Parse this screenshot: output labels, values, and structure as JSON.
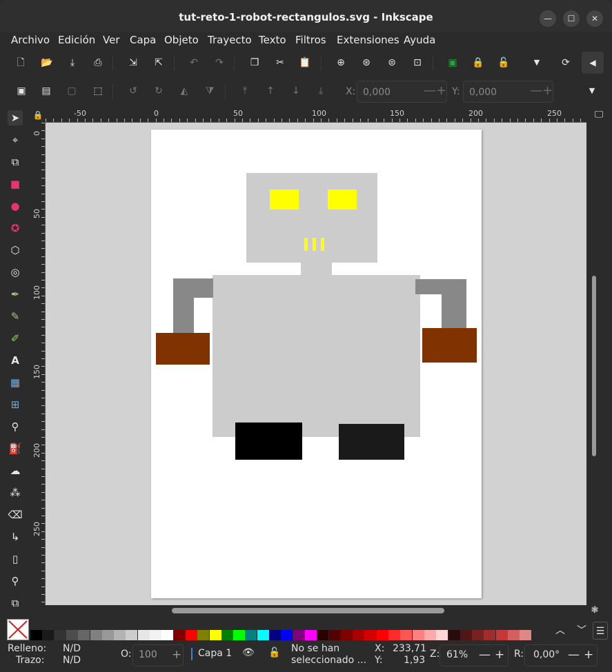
{
  "window": {
    "title": "tut-reto-1-robot-rectangulos.svg - Inkscape",
    "controls": {
      "minimize": "—",
      "maximize": "☐",
      "close": "✕"
    }
  },
  "menu": [
    "Archivo",
    "Edición",
    "Ver",
    "Capa",
    "Objeto",
    "Trayecto",
    "Texto",
    "Filtros",
    "Extensiones",
    "Ayuda"
  ],
  "commands": [
    {
      "name": "new-document-icon",
      "glyph": "🗋"
    },
    {
      "name": "open-icon",
      "glyph": "📂"
    },
    {
      "name": "save-icon",
      "glyph": "⤓"
    },
    {
      "name": "print-icon",
      "glyph": "⎙"
    },
    {
      "name": "import-icon",
      "glyph": "⇲"
    },
    {
      "name": "export-icon",
      "glyph": "⇱"
    },
    {
      "name": "undo-icon",
      "glyph": "↶"
    },
    {
      "name": "redo-icon",
      "glyph": "↷"
    },
    {
      "name": "duplicate-icon",
      "glyph": "❐"
    },
    {
      "name": "cut-icon",
      "glyph": "✂"
    },
    {
      "name": "paste-icon",
      "glyph": "📋"
    },
    {
      "name": "zoom-selection-icon",
      "glyph": "⊕"
    },
    {
      "name": "zoom-drawing-icon",
      "glyph": "⊛"
    },
    {
      "name": "zoom-page-icon",
      "glyph": "⊜"
    },
    {
      "name": "zoom-center-icon",
      "glyph": "⊡"
    },
    {
      "name": "group-icon",
      "glyph": "▣"
    },
    {
      "name": "lock-object-icon",
      "glyph": "🔒"
    },
    {
      "name": "unlock-object-icon",
      "glyph": "🔓"
    },
    {
      "name": "more-dropdown-icon",
      "glyph": "▼"
    },
    {
      "name": "sync-icon",
      "glyph": "⟳"
    },
    {
      "name": "collapse-panel-icon",
      "glyph": "◀"
    }
  ],
  "controls": {
    "x_label": "X:",
    "x_value": "0,000",
    "y_label": "Y:",
    "y_value": "0,000",
    "minus": "—",
    "plus": "+"
  },
  "ruler": {
    "top_labels": [
      "-50",
      "0",
      "50",
      "100",
      "150",
      "200",
      "250"
    ],
    "left_labels": [
      "0",
      "50",
      "100",
      "150",
      "200",
      "250"
    ]
  },
  "drawing": {
    "page_color": "#ffffff",
    "canvas_color": "#d2d2d2",
    "head_color": "#cccccc",
    "eye_color": "#ffff00",
    "body_color": "#cccccc",
    "arm_color": "#888888",
    "hand_color": "#803300",
    "foot_left_color": "#000000",
    "foot_right_color": "#1a1a1a"
  },
  "palette": {
    "none_icon": "no-paint-icon",
    "colors": [
      "#000000",
      "#1a1a1a",
      "#333333",
      "#4d4d4d",
      "#666666",
      "#808080",
      "#999999",
      "#b3b3b3",
      "#cccccc",
      "#e6e6e6",
      "#f2f2f2",
      "#ffffff",
      "#800000",
      "#ff0000",
      "#808000",
      "#ffff00",
      "#008000",
      "#00ff00",
      "#008080",
      "#00ffff",
      "#000080",
      "#0000ff",
      "#800080",
      "#ff00ff",
      "#2b0000",
      "#550000",
      "#800000",
      "#aa0000",
      "#d40000",
      "#ff0000",
      "#ff2a2a",
      "#ff5555",
      "#ff8080",
      "#ffaaaa",
      "#ffd5d5",
      "#280b0b",
      "#501616",
      "#782121",
      "#a02c2c",
      "#c83737",
      "#d35f5f",
      "#de8787"
    ]
  },
  "status": {
    "fill_label": "Relleno:",
    "fill_value": "N/D",
    "stroke_label": "Trazo:",
    "stroke_value": "N/D",
    "opacity_label": "O:",
    "opacity_value": "100",
    "layer": "Capa 1",
    "message": "No se han\nseleccionado ...",
    "cursor_x_label": "X:",
    "cursor_x": "233,71",
    "cursor_y_label": "Y:",
    "cursor_y": "1,93",
    "zoom_label": "Z:",
    "zoom_value": "61%",
    "rotation_label": "R:",
    "rotation_value": "0,00°"
  }
}
